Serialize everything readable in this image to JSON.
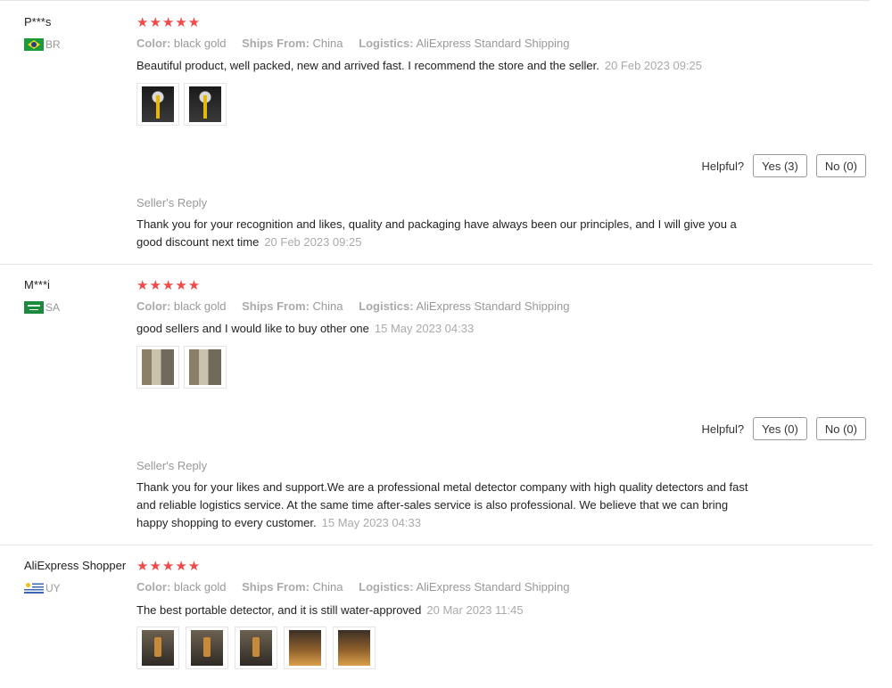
{
  "labels": {
    "color": "Color:",
    "ships_from": "Ships From:",
    "logistics": "Logistics:",
    "helpful": "Helpful?",
    "seller_reply": "Seller's Reply"
  },
  "colors": {
    "star": "#f04a4a",
    "muted": "#999999",
    "border": "#e6e6e6"
  },
  "reviews": [
    {
      "user": "P***s",
      "country": "BR",
      "rating_stars": "★★★★★",
      "rating": 5,
      "color": "black gold",
      "ships_from": "China",
      "logistics": "AliExpress Standard Shipping",
      "text": "Beautiful product, well packed, new and arrived fast. I recommend the store and the seller.",
      "date": "20 Feb 2023 09:25",
      "photos": [
        "detector-photo",
        "detector-photo"
      ],
      "helpful_yes": "Yes (3)",
      "helpful_no": "No (0)",
      "reply_text": "Thank you for your recognition and likes, quality and packaging have always been our principles, and I will give you a good discount next time",
      "reply_date": "20 Feb 2023 09:25"
    },
    {
      "user": "M***i",
      "country": "SA",
      "rating_stars": "★★★★★",
      "rating": 5,
      "color": "black gold",
      "ships_from": "China",
      "logistics": "AliExpress Standard Shipping",
      "text": "good sellers and I would like to buy other one",
      "date": "15 May 2023 04:33",
      "photos": [
        "package-photo",
        "package-photo"
      ],
      "helpful_yes": "Yes (0)",
      "helpful_no": "No (0)",
      "reply_text": "Thank you for your likes and support.We are a professional metal detector company with high quality detectors and fast and reliable logistics service. At the same time after-sales service is also professional. We believe that we can bring happy shopping to every customer.",
      "reply_date": "15 May 2023 04:33"
    },
    {
      "user": "AliExpress Shopper",
      "country": "UY",
      "rating_stars": "★★★★★",
      "rating": 5,
      "color": "black gold",
      "ships_from": "China",
      "logistics": "AliExpress Standard Shipping",
      "text": "The best portable detector, and it is still water-approved",
      "date": "20 Mar 2023 11:45",
      "photos": [
        "detector-photo",
        "detector-photo",
        "detector-photo",
        "detector-photo",
        "detector-photo"
      ]
    }
  ]
}
